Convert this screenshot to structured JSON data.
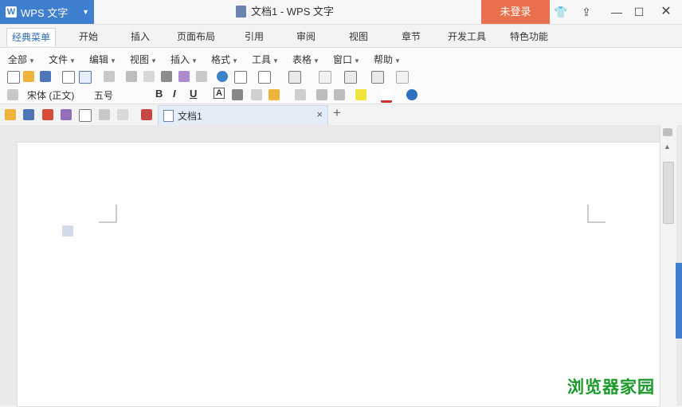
{
  "app": {
    "name": "WPS 文字",
    "window_title": "文档1 - WPS 文字",
    "login_label": "未登录"
  },
  "menu_tabs": [
    "经典菜单",
    "开始",
    "插入",
    "页面布局",
    "引用",
    "审阅",
    "视图",
    "章节",
    "开发工具",
    "特色功能"
  ],
  "menu_items": [
    "全部",
    "文件",
    "编辑",
    "视图",
    "插入",
    "格式",
    "工具",
    "表格",
    "窗口",
    "帮助"
  ],
  "font": {
    "name": "宋体 (正文)",
    "size": "五号"
  },
  "format_buttons": [
    "B",
    "I",
    "U",
    "A"
  ],
  "doc_tab": {
    "label": "文档1",
    "close": "×"
  },
  "new_tab": "+",
  "watermark": "浏览器家园"
}
